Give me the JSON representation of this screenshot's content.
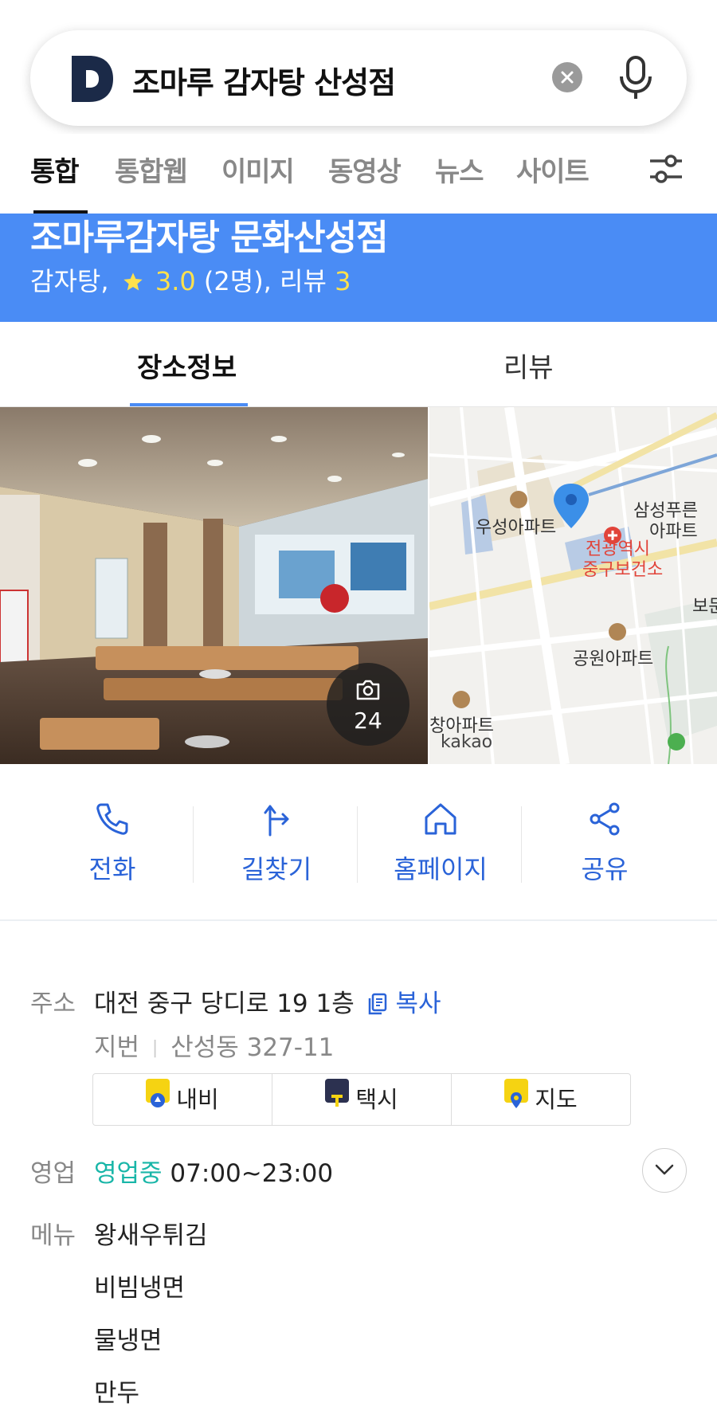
{
  "search": {
    "query": "조마루 감자탕 산성점"
  },
  "tabs": [
    {
      "label": "통합",
      "active": true
    },
    {
      "label": "통합웹",
      "active": false
    },
    {
      "label": "이미지",
      "active": false
    },
    {
      "label": "동영상",
      "active": false
    },
    {
      "label": "뉴스",
      "active": false
    },
    {
      "label": "사이트",
      "active": false
    }
  ],
  "place": {
    "name": "조마루감자탕 문화산성점",
    "category": "감자탕,",
    "rating": "3.0",
    "rating_count": "(2명),",
    "review_label": "리뷰",
    "review_count": "3",
    "header_color": "#4a8cf5"
  },
  "place_tabs": [
    {
      "label": "장소정보",
      "active": true
    },
    {
      "label": "리뷰",
      "active": false
    }
  ],
  "photo": {
    "count": "24"
  },
  "map": {
    "labels": [
      "우성아파트",
      "삼성푸른",
      "아파트",
      "전광역시",
      "중구보건소",
      "보문",
      "공원아파트",
      "창아파트"
    ],
    "brand": "kakao"
  },
  "actions": [
    {
      "label": "전화",
      "icon": "phone-icon"
    },
    {
      "label": "길찾기",
      "icon": "directions-icon"
    },
    {
      "label": "홈페이지",
      "icon": "home-icon"
    },
    {
      "label": "공유",
      "icon": "share-icon"
    }
  ],
  "info": {
    "address_label": "주소",
    "address": "대전 중구 당디로 19 1층",
    "copy_label": "복사",
    "lot_label": "지번",
    "lot_address": "산성동 327-11",
    "nav_buttons": [
      {
        "label": "내비",
        "icon": "navi-icon",
        "color": "#f5d312"
      },
      {
        "label": "택시",
        "icon": "taxi-icon",
        "color": "#2c3150"
      },
      {
        "label": "지도",
        "icon": "map-pin-icon",
        "color": "#f5d312"
      }
    ],
    "hours_label": "영업",
    "open_status": "영업중",
    "hours": "07:00~23:00",
    "menu_label": "메뉴",
    "menu_items": [
      "왕새우튀김",
      "비빔냉면",
      "물냉면",
      "만두"
    ]
  }
}
